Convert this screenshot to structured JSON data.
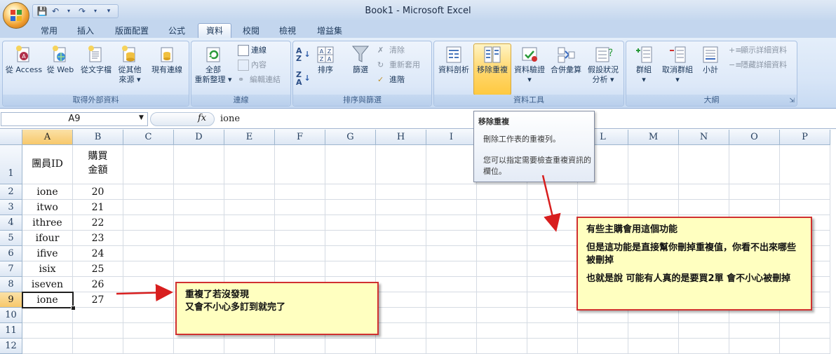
{
  "window": {
    "title": "Book1 - Microsoft Excel"
  },
  "tabs": [
    "常用",
    "插入",
    "版面配置",
    "公式",
    "資料",
    "校閱",
    "檢視",
    "增益集"
  ],
  "active_tab": "資料",
  "ribbon": {
    "external": {
      "label": "取得外部資料",
      "buttons": [
        "從 Access",
        "從 Web",
        "從文字檔",
        "從其他",
        "來源",
        "現有連線"
      ]
    },
    "connections": {
      "label": "連線",
      "refresh_1": "全部",
      "refresh_2": "重新整理",
      "small": [
        "連線",
        "內容",
        "編輯連結"
      ]
    },
    "sort": {
      "label": "排序與篩選",
      "sort": "排序",
      "filter": "篩選",
      "small": [
        "清除",
        "重新套用",
        "進階"
      ]
    },
    "tools": {
      "label": "資料工具",
      "buttons": [
        "資料剖析",
        "移除重複",
        "資料驗證",
        "合併彙算",
        "假設狀況",
        "分析"
      ]
    },
    "outline": {
      "label": "大綱",
      "buttons": [
        "群組",
        "取消群組",
        "小計"
      ],
      "small": [
        "顯示詳細資料",
        "隱藏詳細資料"
      ]
    }
  },
  "formula_bar": {
    "name_box": "A9",
    "fx": "fx",
    "content": "ione"
  },
  "columns": [
    "A",
    "B",
    "C",
    "D",
    "E",
    "F",
    "G",
    "H",
    "I",
    "J",
    "K",
    "L",
    "M",
    "N",
    "O",
    "P"
  ],
  "rows": [
    "1",
    "2",
    "3",
    "4",
    "5",
    "6",
    "7",
    "8",
    "9",
    "10",
    "11",
    "12"
  ],
  "table": {
    "header_a": "團員ID",
    "header_b_1": "購買",
    "header_b_2": "金額",
    "ids": [
      "ione",
      "itwo",
      "ithree",
      "ifour",
      "ifive",
      "isix",
      "iseven",
      "ione"
    ],
    "amounts": [
      "20",
      "21",
      "22",
      "23",
      "24",
      "25",
      "26",
      "27"
    ]
  },
  "tooltip": {
    "title": "移除重複",
    "line1": "刪除工作表的重複列。",
    "line2": "您可以指定需要檢查重複資訊的欄位。"
  },
  "callout_left": {
    "line1": "重複了若沒發現",
    "line2": "又會不小心多訂到就完了"
  },
  "callout_right": {
    "line1": "有些主購會用這個功能",
    "line2": "但是這功能是直接幫你刪掉重複值，你看不出來哪些被刪掉",
    "line3": "也就是說 可能有人真的是要買2單 會不小心被刪掉"
  },
  "colors": {
    "callout_bg": "#ffffc0",
    "callout_border": "#d03030",
    "arrow": "#d81e1e"
  }
}
